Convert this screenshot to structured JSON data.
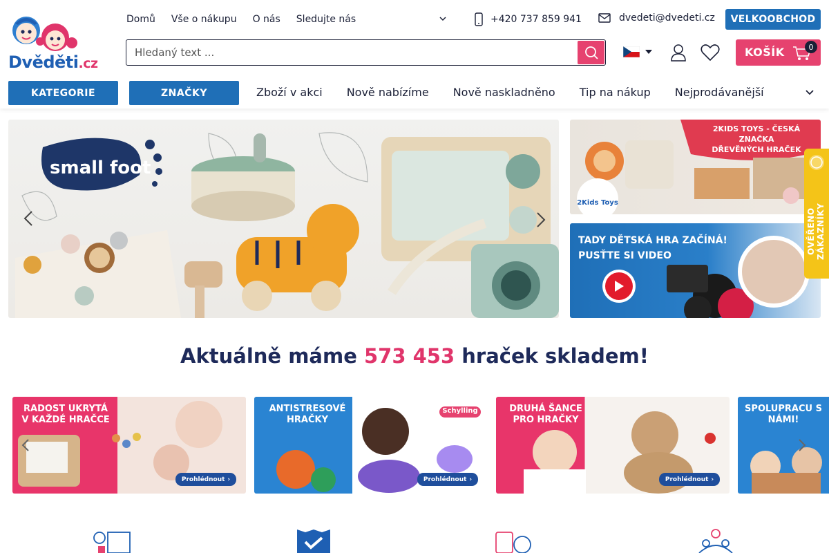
{
  "brand": {
    "name": "Dvěděti",
    "tld": ".cz"
  },
  "topnav": {
    "items": [
      "Domů",
      "Vše o nákupu",
      "O nás",
      "Sledujte nás"
    ]
  },
  "contact": {
    "phone": "+420 737 859 941",
    "email": "dvedeti@dvedeti.cz"
  },
  "wholesale_label": "VELKOOBCHOD",
  "search": {
    "placeholder": "Hledaný text ..."
  },
  "cart": {
    "label": "KOŠÍK",
    "count": "0"
  },
  "category_buttons": {
    "categories": "KATEGORIE",
    "brands": "ZNAČKY"
  },
  "mainnav": {
    "items": [
      "Zboží v akci",
      "Nově nabízíme",
      "Nově naskladněno",
      "Tip na nákup",
      "Nejprodávanější"
    ]
  },
  "hero": {
    "brand_text": "small foot",
    "slides_count": 5,
    "active_slide": 1
  },
  "side_banners": {
    "top": {
      "heading_line1": "2KIDS TOYS - ČESKÁ ZNAČKA",
      "heading_line2": "DŘEVĚNÝCH HRAČEK",
      "logo_text": "2Kids Toys"
    },
    "bottom": {
      "heading_line1": "TADY DĚTSKÁ HRA ZAČÍNÁ!",
      "heading_line2": "PUSŤTE SI VIDEO"
    }
  },
  "verified_badge": "OVĚŘENO ZÁKAZNÍKY",
  "stock": {
    "prefix": "Aktuálně máme",
    "number": "573 453",
    "suffix": "hraček skladem!"
  },
  "promos": [
    {
      "title": "RADOST UKRYTÁ V KAŽDÉ HRAČCE",
      "cta": "Prohlédnout"
    },
    {
      "title": "ANTISTRESOVÉ HRAČKY",
      "cta": "Prohlédnout",
      "tag": "Schylling"
    },
    {
      "title": "DRUHÁ ŠANCE PRO HRAČKY",
      "cta": "Prohlédnout"
    },
    {
      "title": "SPOLUPRACU S NÁMI!",
      "cta": ""
    }
  ],
  "colors": {
    "primary_blue": "#1f6fb7",
    "accent_pink": "#e6426f",
    "navy_text": "#1e2a5a",
    "badge_yellow": "#f4c418"
  }
}
